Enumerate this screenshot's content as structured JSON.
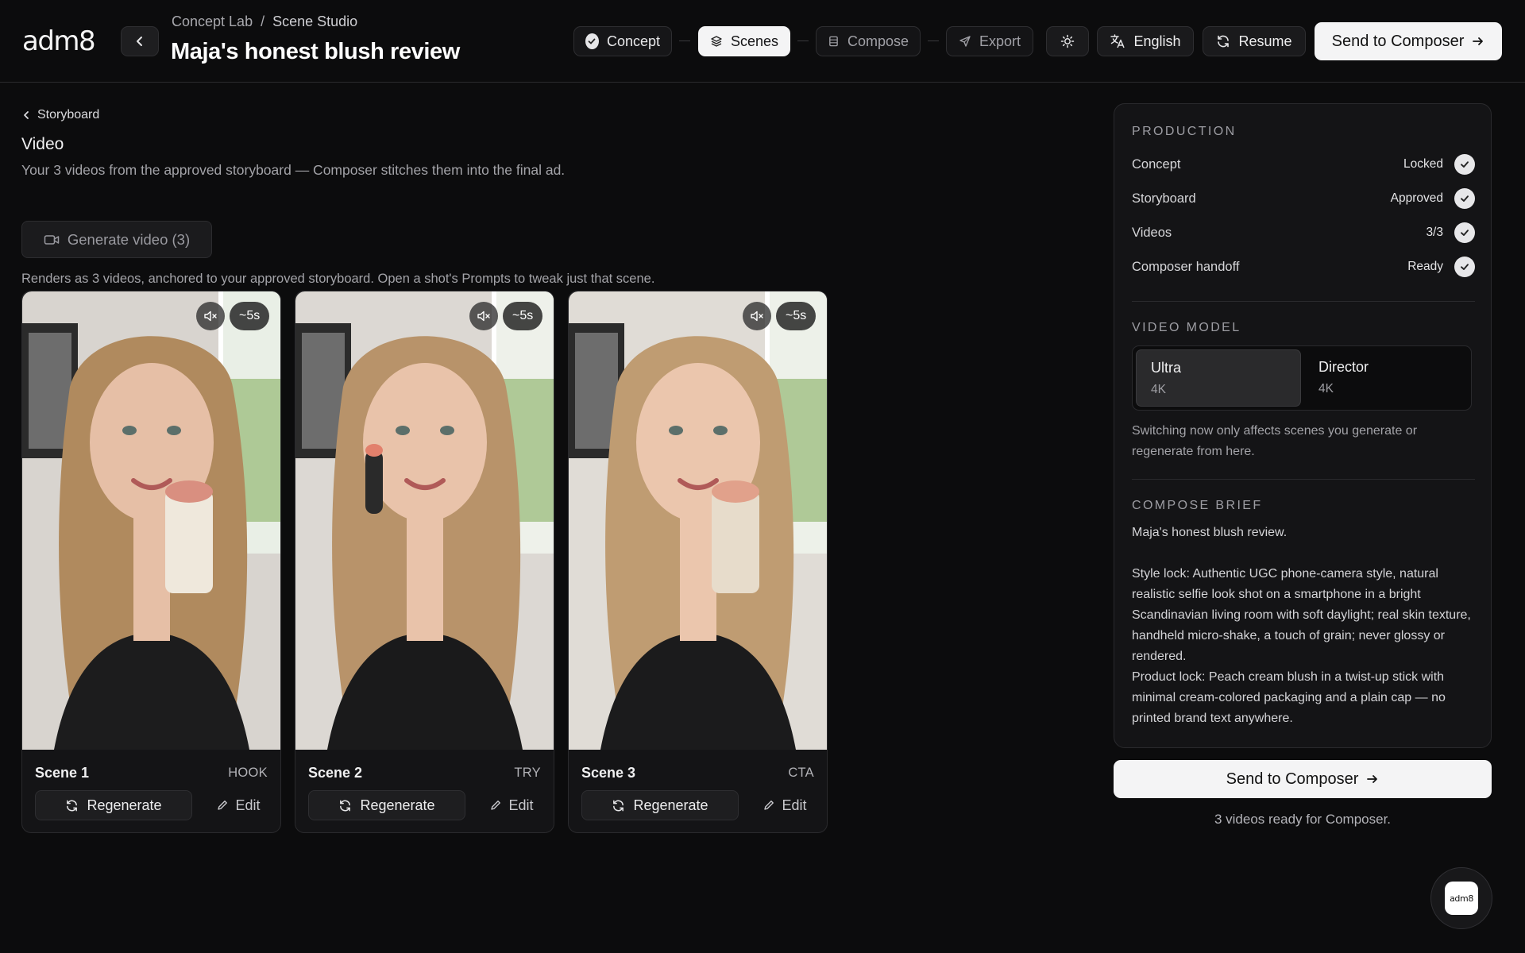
{
  "app": {
    "logo": "adm8",
    "breadcrumb": {
      "parent": "Concept Lab",
      "separator": "/",
      "current": "Scene Studio"
    },
    "title": "Maja's honest blush review"
  },
  "steps": [
    {
      "label": "Concept",
      "state": "done"
    },
    {
      "label": "Scenes",
      "state": "active"
    },
    {
      "label": "Compose",
      "state": "pending"
    },
    {
      "label": "Export",
      "state": "pending"
    }
  ],
  "toolbar": {
    "language_label": "English",
    "resume_label": "Resume",
    "send_label": "Send to Composer"
  },
  "main": {
    "back_link": "Storyboard",
    "section_title": "Video",
    "section_description": "Your 3 videos from the approved storyboard — Composer stitches them into the final ad.",
    "generate_label": "Generate video (3)",
    "renders_note": "Renders as 3 videos, anchored to your approved storyboard. Open a shot's Prompts to tweak just that scene."
  },
  "scenes": [
    {
      "name": "Scene 1",
      "tag": "HOOK",
      "duration": "~5s",
      "regenerate_label": "Regenerate",
      "edit_label": "Edit"
    },
    {
      "name": "Scene 2",
      "tag": "TRY",
      "duration": "~5s",
      "regenerate_label": "Regenerate",
      "edit_label": "Edit"
    },
    {
      "name": "Scene 3",
      "tag": "CTA",
      "duration": "~5s",
      "regenerate_label": "Regenerate",
      "edit_label": "Edit"
    }
  ],
  "panel": {
    "production_heading": "PRODUCTION",
    "production": [
      {
        "label": "Concept",
        "status": "Locked"
      },
      {
        "label": "Storyboard",
        "status": "Approved"
      },
      {
        "label": "Videos",
        "status": "3/3"
      },
      {
        "label": "Composer handoff",
        "status": "Ready"
      }
    ],
    "video_model_heading": "VIDEO MODEL",
    "models": [
      {
        "name": "Ultra",
        "resolution": "4K",
        "selected": true
      },
      {
        "name": "Director",
        "resolution": "4K",
        "selected": false
      }
    ],
    "model_note": "Switching now only affects scenes you generate or regenerate from here.",
    "compose_brief_heading": "COMPOSE BRIEF",
    "brief_intro": "Maja's honest blush review.",
    "style_lock": "Style lock: Authentic UGC phone-camera style, natural realistic selfie look shot on a smartphone in a bright Scandinavian living room with soft daylight; real skin texture, handheld micro-shake, a touch of grain; never glossy or rendered.",
    "product_lock": "Product lock: Peach cream blush in a twist-up stick with minimal cream-colored packaging and a plain cap — no printed brand text anywhere."
  },
  "footer": {
    "send_label": "Send to Composer",
    "ready_note": "3 videos ready for Composer.",
    "fab_label": "adm8"
  },
  "colors": {
    "background": "#0c0c0d",
    "surface": "#141416",
    "border": "#2a2a2d",
    "primary_button": "#f4f4f5",
    "text_muted": "#a3a3a8"
  },
  "icons": [
    "chevron-left-icon",
    "check-circle-icon",
    "layers-icon",
    "film-icon",
    "send-icon",
    "sun-icon",
    "translate-icon",
    "refresh-icon",
    "arrow-right-icon",
    "video-camera-icon",
    "mute-icon",
    "pencil-icon"
  ]
}
